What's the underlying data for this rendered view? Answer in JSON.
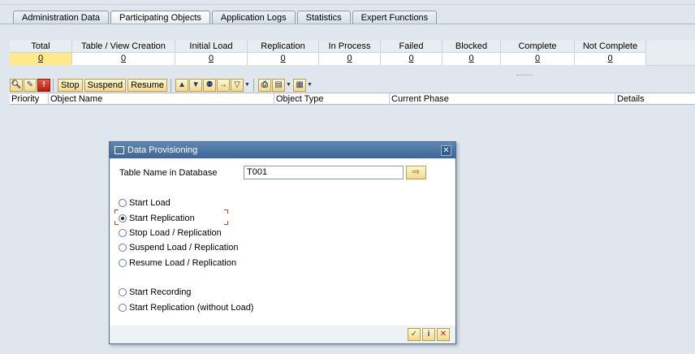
{
  "tabs": [
    {
      "label": "Administration Data",
      "active": false
    },
    {
      "label": "Participating Objects",
      "active": true
    },
    {
      "label": "Application Logs",
      "active": false
    },
    {
      "label": "Statistics",
      "active": false
    },
    {
      "label": "Expert Functions",
      "active": false
    }
  ],
  "summary": {
    "columns": [
      {
        "header": "Total",
        "value": "0"
      },
      {
        "header": "Table / View Creation",
        "value": "0"
      },
      {
        "header": "Initial Load",
        "value": "0"
      },
      {
        "header": "Replication",
        "value": "0"
      },
      {
        "header": "In Process",
        "value": "0"
      },
      {
        "header": "Failed",
        "value": "0"
      },
      {
        "header": "Blocked",
        "value": "0"
      },
      {
        "header": "Complete",
        "value": "0"
      },
      {
        "header": "Not Complete",
        "value": "0"
      }
    ]
  },
  "toolbar": {
    "stop_label": "Stop",
    "suspend_label": "Suspend",
    "resume_label": "Resume"
  },
  "grid": {
    "columns": [
      "Priority",
      "Object Name",
      "Object Type",
      "Current Phase",
      "Details"
    ]
  },
  "dialog": {
    "title": "Data Provisioning",
    "table_label": "Table Name in Database",
    "table_value": "T001",
    "options": [
      {
        "label": "Start Load",
        "selected": false
      },
      {
        "label": "Start Replication",
        "selected": true
      },
      {
        "label": "Stop Load / Replication",
        "selected": false
      },
      {
        "label": "Suspend Load / Replication",
        "selected": false
      },
      {
        "label": "Resume Load / Replication",
        "selected": false
      },
      {
        "label": "Start Recording",
        "selected": false
      },
      {
        "label": "Start Replication (without Load)",
        "selected": false
      }
    ]
  },
  "colors": {
    "selected_cell": "#ffe98a",
    "dialog_titlebar": "#4a72a0",
    "background": "#dfe6ee"
  }
}
